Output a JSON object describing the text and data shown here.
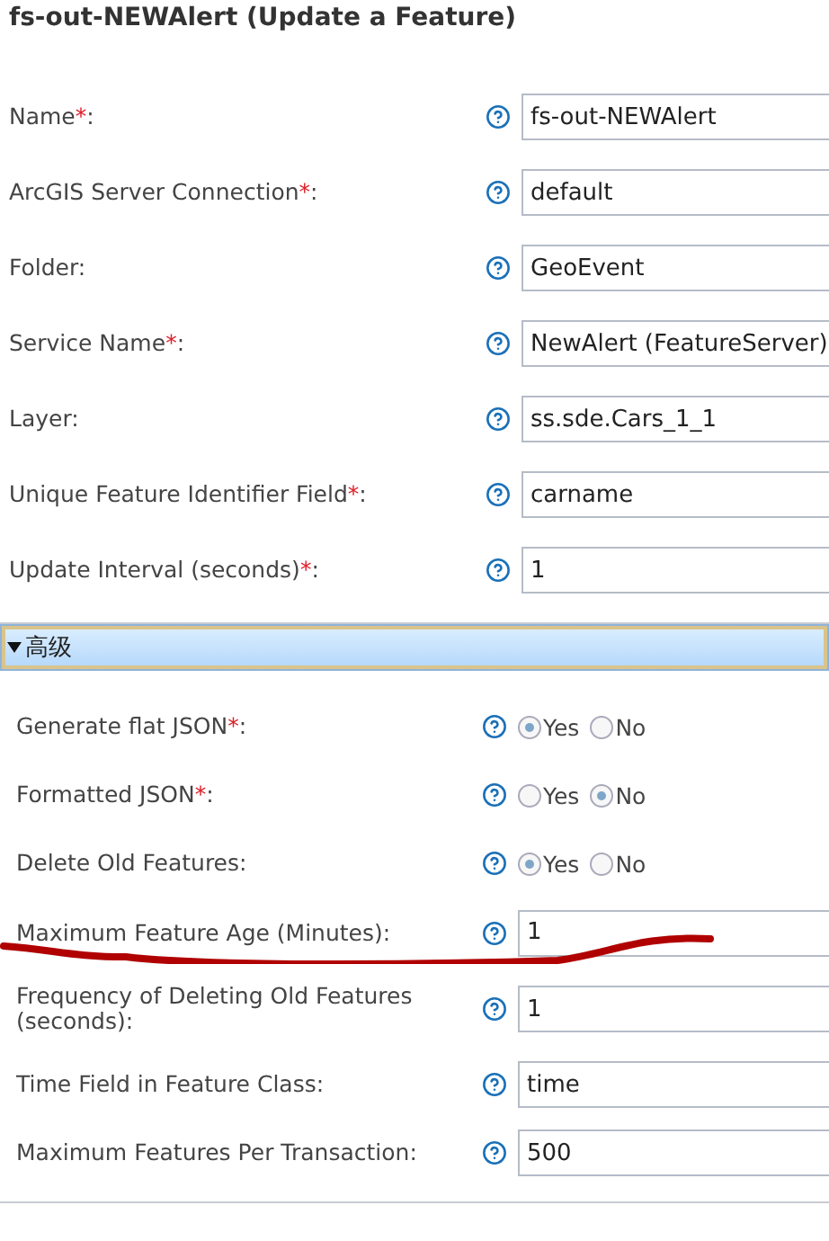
{
  "title": "fs-out-NEWAlert (Update a Feature)",
  "fields": [
    {
      "kind": "text",
      "label": "Name",
      "required_mark": "*",
      "colon": ":",
      "value": "fs-out-NEWAlert"
    },
    {
      "kind": "text",
      "label": "ArcGIS Server Connection",
      "required_mark": "*",
      "colon": ":",
      "value": "default"
    },
    {
      "kind": "text",
      "label": "Folder:",
      "value": "GeoEvent"
    },
    {
      "kind": "text",
      "label": "Service Name",
      "required_mark": "*",
      "colon": ":",
      "value": "NewAlert (FeatureServer)"
    },
    {
      "kind": "text",
      "label": "Layer:",
      "value": "ss.sde.Cars_1_1"
    },
    {
      "kind": "text",
      "label": "Unique Feature Identifier Field",
      "required_mark": "*",
      "colon": ":",
      "value": "carname"
    },
    {
      "kind": "text",
      "label": "Update Interval (seconds)",
      "required_mark": "*",
      "colon": ":",
      "value": "1"
    }
  ],
  "advanced": {
    "title": "高级",
    "expanded": true,
    "fields": [
      {
        "kind": "radio",
        "label": "Generate flat JSON",
        "required_mark": "*",
        "colon": ":",
        "options": [
          {
            "label": "Yes",
            "selected": true
          },
          {
            "label": "No",
            "selected": false
          }
        ]
      },
      {
        "kind": "radio",
        "label": "Formatted JSON",
        "required_mark": "*",
        "colon": ":",
        "options": [
          {
            "label": "Yes",
            "selected": false
          },
          {
            "label": "No",
            "selected": true
          }
        ]
      },
      {
        "kind": "radio",
        "label": "Delete Old Features:",
        "options": [
          {
            "label": "Yes",
            "selected": true
          },
          {
            "label": "No",
            "selected": false
          }
        ]
      },
      {
        "kind": "text",
        "label": "Maximum Feature Age (Minutes):",
        "value": "1"
      },
      {
        "kind": "text",
        "label": "Frequency of Deleting Old Features (seconds):",
        "value": "1"
      },
      {
        "kind": "text",
        "label": "Time Field in Feature Class:",
        "value": "time"
      },
      {
        "kind": "text",
        "label": "Maximum Features Per Transaction:",
        "value": "500"
      }
    ]
  }
}
